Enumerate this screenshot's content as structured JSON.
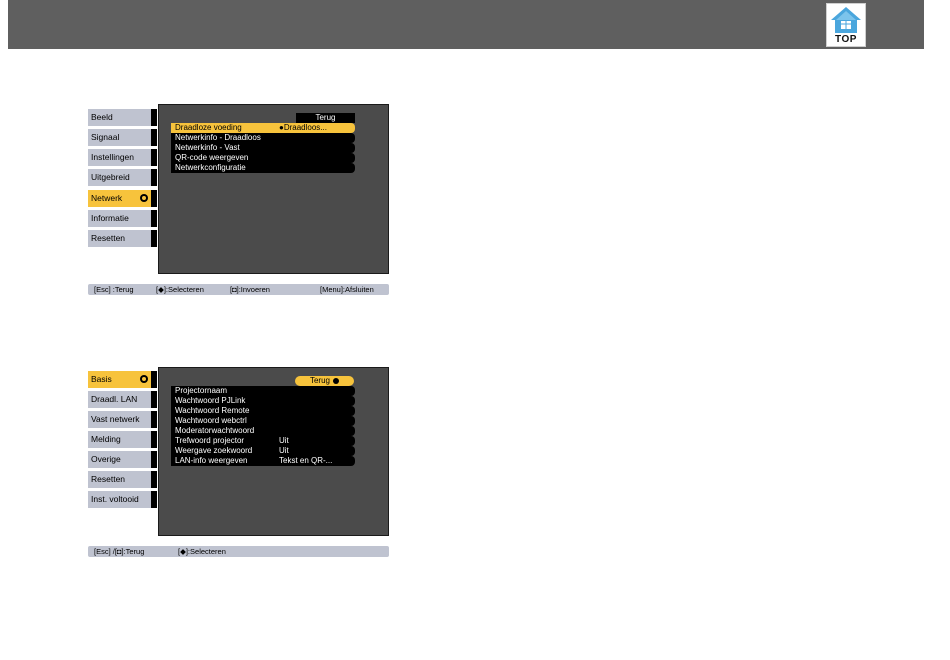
{
  "header": {
    "top_label": "TOP",
    "icon": "home-icon"
  },
  "menu_network": {
    "sidebar": [
      "Beeld",
      "Signaal",
      "Instellingen",
      "Uitgebreid",
      "Netwerk",
      "Informatie",
      "Resetten"
    ],
    "active_index": 4,
    "back_label": "Terug",
    "items": [
      {
        "label": "Draadloze voeding",
        "value": "●Draadloos..."
      },
      {
        "label": "Netwerkinfo - Draadloos",
        "value": ""
      },
      {
        "label": "Netwerkinfo - Vast",
        "value": ""
      },
      {
        "label": "QR-code weergeven",
        "value": ""
      },
      {
        "label": "Netwerkconfiguratie",
        "value": ""
      }
    ],
    "hint": [
      "[Esc] :Terug",
      "[◆]:Selecteren",
      "[◘]:Invoeren",
      "[Menu]:Afsluiten"
    ]
  },
  "menu_basic": {
    "sidebar": [
      "Basis",
      "Draadl. LAN",
      "Vast netwerk",
      "Melding",
      "Overige",
      "Resetten",
      "Inst. voltooid"
    ],
    "active_index": 0,
    "back_label": "Terug",
    "items": [
      {
        "label": "Projectornaam",
        "value": ""
      },
      {
        "label": "Wachtwoord PJLink",
        "value": ""
      },
      {
        "label": "Wachtwoord Remote",
        "value": ""
      },
      {
        "label": "Wachtwoord webctrl",
        "value": ""
      },
      {
        "label": "Moderatorwachtwoord",
        "value": ""
      },
      {
        "label": "Trefwoord projector",
        "value": "Uit"
      },
      {
        "label": "Weergave zoekwoord",
        "value": "Uit"
      },
      {
        "label": "LAN-info weergeven",
        "value": "Tekst en QR-..."
      }
    ],
    "hint": [
      "[Esc] /[◘]:Terug",
      "[◆]:Selecteren"
    ]
  },
  "colors": {
    "header_bg": "#5f5f5f",
    "highlight": "#f7c33c",
    "sidebar_bg": "#bfc3d0",
    "panel_bg": "#4b4b4b"
  }
}
